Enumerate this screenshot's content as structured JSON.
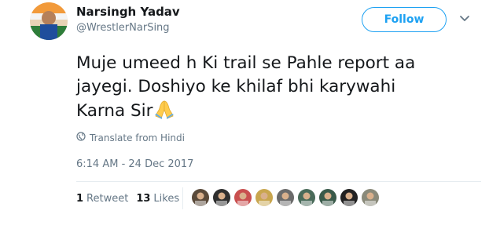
{
  "author": {
    "display_name": "Narsingh Yadav",
    "handle": "@WrestlerNarSing",
    "avatar_icon": "profile-photo"
  },
  "follow_button": {
    "label": "Follow",
    "color": "#1da1f2"
  },
  "more_menu_icon": "chevron-down-icon",
  "tweet": {
    "line1": "Muje umeed h Ki trail se Pahle report aa",
    "line2": "jayegi. Doshiyo ke khilaf bhi karywahi",
    "line3": "Karna Sir",
    "emoji": "folded-hands-emoji"
  },
  "translate": {
    "icon": "globe-icon",
    "label": "Translate from Hindi"
  },
  "timestamp": "6:14 AM - 24 Dec 2017",
  "stats": {
    "retweets_count": "1",
    "retweets_label": "Retweet",
    "likes_count": "13",
    "likes_label": "Likes"
  },
  "likers": [
    {
      "color": "#5a4a3a"
    },
    {
      "color": "#2f2f2f"
    },
    {
      "color": "#c94f4f"
    },
    {
      "color": "#c9a64f"
    },
    {
      "color": "#6b6b6b"
    },
    {
      "color": "#4a6b5a"
    },
    {
      "color": "#3a5a4a"
    },
    {
      "color": "#222222"
    },
    {
      "color": "#8a8a7a"
    }
  ],
  "colors": {
    "text_primary": "#14171a",
    "text_secondary": "#657786",
    "accent": "#1da1f2"
  }
}
